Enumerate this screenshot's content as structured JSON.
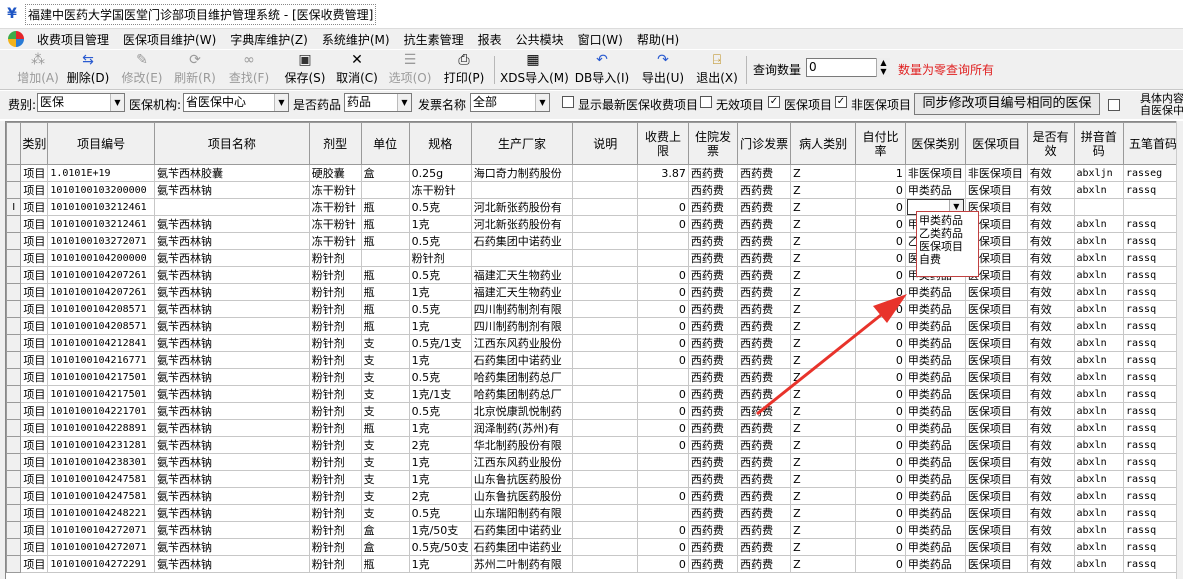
{
  "window": {
    "title": "福建中医药大学国医堂门诊部项目维护管理系统 - [医保收费管理]"
  },
  "menu": [
    "收费项目管理",
    "医保项目维护(W)",
    "字典库维护(Z)",
    "系统维护(M)",
    "抗生素管理",
    "报表",
    "公共模块",
    "窗口(W)",
    "帮助(H)"
  ],
  "toolbar": {
    "add": "增加(A)",
    "delete": "删除(D)",
    "modify": "修改(E)",
    "refresh": "刷新(R)",
    "find": "查找(F)",
    "save": "保存(S)",
    "cancel": "取消(C)",
    "select": "选项(O)",
    "print": "打印(P)",
    "xds_import": "XDS导入(M)",
    "db_import": "DB导入(I)",
    "export": "导出(U)",
    "exit": "退出(X)",
    "query_label": "查询数量",
    "query_value": "0",
    "query_hint": "数量为零查询所有"
  },
  "filters": {
    "fee_label": "费别:",
    "fee_value": "医保",
    "org_label": "医保机构:",
    "org_value": "省医保中心",
    "is_drug_label": "是否药品",
    "is_drug_value": "药品",
    "invoice_label": "发票名称",
    "invoice_value": "全部",
    "show_latest": "显示最新医保收费项目",
    "invalid_items": "无效项目",
    "insured_items": "医保项目",
    "non_insured_items": "非医保项目",
    "sync_button": "同步修改项目编号相同的医保",
    "detail_label_1": "具体内容",
    "detail_label_2": "自医保中"
  },
  "grid": {
    "columns": [
      "类别",
      "项目编号",
      "项目名称",
      "剂型",
      "单位",
      "规格",
      "生产厂家",
      "说明",
      "收费上限",
      "住院发票",
      "门诊发票",
      "病人类别",
      "自付比率",
      "医保类别",
      "医保项目",
      "是否有效",
      "拼音首码",
      "五笔首码"
    ],
    "rows": [
      [
        "项目",
        "1.0101E+19",
        "氨苄西林胶囊",
        "硬胶囊",
        "盒",
        "0.25g",
        "海口奇力制药股份",
        "",
        "3.87",
        "西药费",
        "西药费",
        "Z",
        "1",
        "非医保项目",
        "非医保项目",
        "有效",
        "abxljn",
        "rasseg"
      ],
      [
        "项目",
        "1010100103200000",
        "氨苄西林钠",
        "冻干粉针",
        "",
        "冻干粉针",
        "",
        "",
        "",
        "西药费",
        "西药费",
        "Z",
        "0",
        "甲类药品",
        "医保项目",
        "有效",
        "abxln",
        "rassq"
      ],
      [
        "项目",
        "1010100103212461",
        "",
        "冻干粉针",
        "瓶",
        "0.5克",
        "河北新张药股份有",
        "",
        "0",
        "西药费",
        "西药费",
        "Z",
        "0",
        "",
        "医保项目",
        "有效",
        "",
        ""
      ],
      [
        "项目",
        "1010100103212461",
        "氨苄西林钠",
        "冻干粉针",
        "瓶",
        "1克",
        "河北新张药股份有",
        "",
        "0",
        "西药费",
        "西药费",
        "Z",
        "0",
        "甲类药品",
        "医保项目",
        "有效",
        "abxln",
        "rassq"
      ],
      [
        "项目",
        "1010100103272071",
        "氨苄西林钠",
        "冻干粉针",
        "瓶",
        "0.5克",
        "石药集团中诺药业",
        "",
        "",
        "西药费",
        "西药费",
        "Z",
        "0",
        "乙类药品",
        "医保项目",
        "有效",
        "abxln",
        "rassq"
      ],
      [
        "项目",
        "1010100104200000",
        "氨苄西林钠",
        "粉针剂",
        "",
        "粉针剂",
        "",
        "",
        "",
        "西药费",
        "西药费",
        "Z",
        "0",
        "医保项目",
        "医保项目",
        "有效",
        "abxln",
        "rassq"
      ],
      [
        "项目",
        "1010100104207261",
        "氨苄西林钠",
        "粉针剂",
        "瓶",
        "0.5克",
        "福建汇天生物药业",
        "",
        "0",
        "西药费",
        "西药费",
        "Z",
        "0",
        "甲类药品",
        "医保项目",
        "有效",
        "abxln",
        "rassq"
      ],
      [
        "项目",
        "1010100104207261",
        "氨苄西林钠",
        "粉针剂",
        "瓶",
        "1克",
        "福建汇天生物药业",
        "",
        "0",
        "西药费",
        "西药费",
        "Z",
        "0",
        "甲类药品",
        "医保项目",
        "有效",
        "abxln",
        "rassq"
      ],
      [
        "项目",
        "1010100104208571",
        "氨苄西林钠",
        "粉针剂",
        "瓶",
        "0.5克",
        "四川制药制剂有限",
        "",
        "0",
        "西药费",
        "西药费",
        "Z",
        "0",
        "甲类药品",
        "医保项目",
        "有效",
        "abxln",
        "rassq"
      ],
      [
        "项目",
        "1010100104208571",
        "氨苄西林钠",
        "粉针剂",
        "瓶",
        "1克",
        "四川制药制剂有限",
        "",
        "0",
        "西药费",
        "西药费",
        "Z",
        "0",
        "甲类药品",
        "医保项目",
        "有效",
        "abxln",
        "rassq"
      ],
      [
        "项目",
        "1010100104212841",
        "氨苄西林钠",
        "粉针剂",
        "支",
        "0.5克/1支",
        "江西东风药业股份",
        "",
        "0",
        "西药费",
        "西药费",
        "Z",
        "0",
        "甲类药品",
        "医保项目",
        "有效",
        "abxln",
        "rassq"
      ],
      [
        "项目",
        "1010100104216771",
        "氨苄西林钠",
        "粉针剂",
        "支",
        "1克",
        "石药集团中诺药业",
        "",
        "0",
        "西药费",
        "西药费",
        "Z",
        "0",
        "甲类药品",
        "医保项目",
        "有效",
        "abxln",
        "rassq"
      ],
      [
        "项目",
        "1010100104217501",
        "氨苄西林钠",
        "粉针剂",
        "支",
        "0.5克",
        "哈药集团制药总厂",
        "",
        "",
        "西药费",
        "西药费",
        "Z",
        "0",
        "甲类药品",
        "医保项目",
        "有效",
        "abxln",
        "rassq"
      ],
      [
        "项目",
        "1010100104217501",
        "氨苄西林钠",
        "粉针剂",
        "支",
        "1克/1支",
        "哈药集团制药总厂",
        "",
        "0",
        "西药费",
        "西药费",
        "Z",
        "0",
        "甲类药品",
        "医保项目",
        "有效",
        "abxln",
        "rassq"
      ],
      [
        "项目",
        "1010100104221701",
        "氨苄西林钠",
        "粉针剂",
        "支",
        "0.5克",
        "北京悦康凯悦制药",
        "",
        "0",
        "西药费",
        "西药费",
        "Z",
        "0",
        "甲类药品",
        "医保项目",
        "有效",
        "abxln",
        "rassq"
      ],
      [
        "项目",
        "1010100104228891",
        "氨苄西林钠",
        "粉针剂",
        "瓶",
        "1克",
        "润泽制药(苏州)有",
        "",
        "0",
        "西药费",
        "西药费",
        "Z",
        "0",
        "甲类药品",
        "医保项目",
        "有效",
        "abxln",
        "rassq"
      ],
      [
        "项目",
        "1010100104231281",
        "氨苄西林钠",
        "粉针剂",
        "支",
        "2克",
        "华北制药股份有限",
        "",
        "0",
        "西药费",
        "西药费",
        "Z",
        "0",
        "甲类药品",
        "医保项目",
        "有效",
        "abxln",
        "rassq"
      ],
      [
        "项目",
        "1010100104238301",
        "氨苄西林钠",
        "粉针剂",
        "支",
        "1克",
        "江西东风药业股份",
        "",
        "",
        "西药费",
        "西药费",
        "Z",
        "0",
        "甲类药品",
        "医保项目",
        "有效",
        "abxln",
        "rassq"
      ],
      [
        "项目",
        "1010100104247581",
        "氨苄西林钠",
        "粉针剂",
        "支",
        "1克",
        "山东鲁抗医药股份",
        "",
        "",
        "西药费",
        "西药费",
        "Z",
        "0",
        "甲类药品",
        "医保项目",
        "有效",
        "abxln",
        "rassq"
      ],
      [
        "项目",
        "1010100104247581",
        "氨苄西林钠",
        "粉针剂",
        "支",
        "2克",
        "山东鲁抗医药股份",
        "",
        "0",
        "西药费",
        "西药费",
        "Z",
        "0",
        "甲类药品",
        "医保项目",
        "有效",
        "abxln",
        "rassq"
      ],
      [
        "项目",
        "1010100104248221",
        "氨苄西林钠",
        "粉针剂",
        "支",
        "0.5克",
        "山东瑞阳制药有限",
        "",
        "",
        "西药费",
        "西药费",
        "Z",
        "0",
        "甲类药品",
        "医保项目",
        "有效",
        "abxln",
        "rassq"
      ],
      [
        "项目",
        "1010100104272071",
        "氨苄西林钠",
        "粉针剂",
        "盒",
        "1克/50支",
        "石药集团中诺药业",
        "",
        "0",
        "西药费",
        "西药费",
        "Z",
        "0",
        "甲类药品",
        "医保项目",
        "有效",
        "abxln",
        "rassq"
      ],
      [
        "项目",
        "1010100104272071",
        "氨苄西林钠",
        "粉针剂",
        "盒",
        "0.5克/50支",
        "石药集团中诺药业",
        "",
        "0",
        "西药费",
        "西药费",
        "Z",
        "0",
        "甲类药品",
        "医保项目",
        "有效",
        "abxln",
        "rassq"
      ],
      [
        "项目",
        "1010100104272291",
        "氨苄西林钠",
        "粉针剂",
        "瓶",
        "1克",
        "苏州二叶制药有限",
        "",
        "0",
        "西药费",
        "西药费",
        "Z",
        "0",
        "甲类药品",
        "医保项目",
        "有效",
        "abxln",
        "rassq"
      ]
    ]
  },
  "dropdown": {
    "options": [
      "甲类药品",
      "乙类药品",
      "医保项目",
      "自费"
    ],
    "edit_value": ""
  },
  "colors": {
    "hint_red": "#e02020",
    "annotation_arrow": "#e8332b",
    "grid_border": "#c7c7c7",
    "header_bg": "#f0f0f0"
  }
}
